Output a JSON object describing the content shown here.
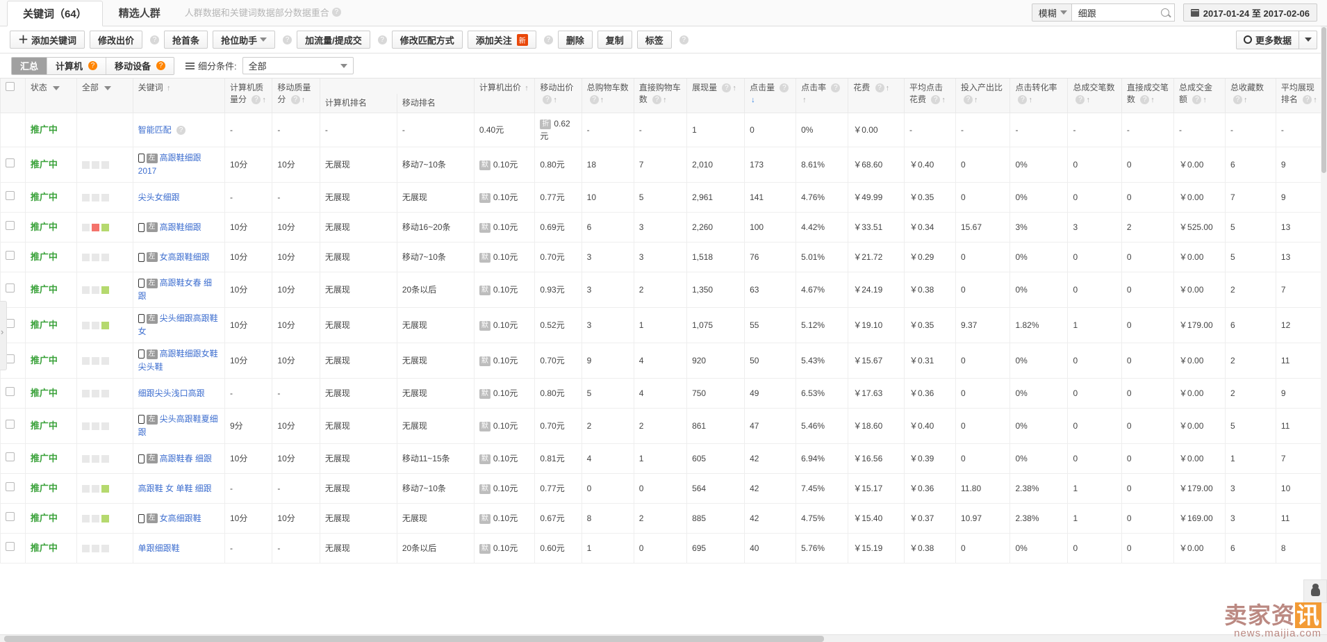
{
  "tabs": {
    "keyword_tab": "关键词（64）",
    "crowd_tab": "精选人群",
    "note": "人群数据和关键词数据部分数据重合"
  },
  "search": {
    "match_mode": "模糊",
    "value": "细跟",
    "icon": "search-icon"
  },
  "date_range": "2017-01-24 至 2017-02-06",
  "toolbar": {
    "add_keyword": "添加关键词",
    "modify_bid": "修改出价",
    "grab_top": "抢首条",
    "grab_assistant": "抢位助手",
    "add_traffic": "加流量/提成交",
    "modify_match": "修改匹配方式",
    "add_follow": "添加关注",
    "follow_badge": "新",
    "delete": "删除",
    "copy": "复制",
    "tag": "标签",
    "more_data": "更多数据"
  },
  "filters": {
    "summary": "汇总",
    "computer": "计算机",
    "mobile": "移动设备",
    "segment_label": "细分条件:",
    "segment_value": "全部"
  },
  "table": {
    "headers": {
      "status": "状态",
      "all": "全部",
      "keyword": "关键词",
      "pc_quality": "计算机质量分",
      "mobile_quality": "移动质量分",
      "pc_rank": "计算机排名",
      "mobile_rank": "移动排名",
      "pc_bid": "计算机出价",
      "mobile_bid": "移动出价",
      "total_cart": "总购物车数",
      "direct_cart": "直接购物车数",
      "impressions": "展现量",
      "clicks": "点击量",
      "ctr": "点击率",
      "cost": "花费",
      "avg_cpc": "平均点击花费",
      "roi": "投入产出比",
      "cvr": "点击转化率",
      "total_orders": "总成交笔数",
      "direct_orders": "直接成交笔数",
      "total_amount": "总成交金额",
      "total_favorites": "总收藏数",
      "avg_rank": "平均展现排名"
    },
    "labels": {
      "no_show": "无展现",
      "status_promoting": "推广中",
      "smart_match": "智能匹配",
      "tag_left": "左",
      "tag_default": "默",
      "tag_discount": "折"
    },
    "rows": [
      {
        "status": "推广中",
        "checkbox": false,
        "squares": [],
        "keyword": "智能匹配",
        "keyword_help": true,
        "mobile_icon": false,
        "left_tag": false,
        "pc_quality": "-",
        "mobile_quality": "-",
        "pc_rank": "-",
        "mobile_rank": "-",
        "pc_bid": "0.40元",
        "pc_bid_tag": "",
        "mobile_bid": "0.62元",
        "mobile_bid_tag": "折",
        "total_cart": "-",
        "direct_cart": "-",
        "impressions": "1",
        "clicks": "0",
        "ctr": "0%",
        "cost": "￥0.00",
        "avg_cpc": "-",
        "roi": "-",
        "cvr": "-",
        "total_orders": "-",
        "direct_orders": "-",
        "total_amount": "-",
        "total_favorites": "-",
        "avg_rank": "-"
      },
      {
        "status": "推广中",
        "checkbox": true,
        "squares": [
          "#e8e8e8",
          "#e8e8e8",
          "#e8e8e8"
        ],
        "keyword": "高跟鞋细跟2017",
        "keyword_help": false,
        "mobile_icon": true,
        "left_tag": true,
        "pc_quality": "10分",
        "mobile_quality": "10分",
        "pc_rank": "无展现",
        "mobile_rank": "移动7~10条",
        "pc_bid": "0.10元",
        "pc_bid_tag": "默",
        "mobile_bid": "0.80元",
        "mobile_bid_tag": "",
        "total_cart": "18",
        "direct_cart": "7",
        "impressions": "2,010",
        "clicks": "173",
        "ctr": "8.61%",
        "cost": "￥68.60",
        "avg_cpc": "￥0.40",
        "roi": "0",
        "cvr": "0%",
        "total_orders": "0",
        "direct_orders": "0",
        "total_amount": "￥0.00",
        "total_favorites": "6",
        "avg_rank": "9"
      },
      {
        "status": "推广中",
        "checkbox": true,
        "squares": [
          "#e8e8e8",
          "#e8e8e8",
          "#e8e8e8"
        ],
        "keyword": "尖头女细跟",
        "keyword_help": false,
        "mobile_icon": false,
        "left_tag": false,
        "pc_quality": "-",
        "mobile_quality": "-",
        "pc_rank": "无展现",
        "mobile_rank": "无展现",
        "pc_bid": "0.10元",
        "pc_bid_tag": "默",
        "mobile_bid": "0.77元",
        "mobile_bid_tag": "",
        "total_cart": "10",
        "direct_cart": "5",
        "impressions": "2,961",
        "clicks": "141",
        "ctr": "4.76%",
        "cost": "￥49.99",
        "avg_cpc": "￥0.35",
        "roi": "0",
        "cvr": "0%",
        "total_orders": "0",
        "direct_orders": "0",
        "total_amount": "￥0.00",
        "total_favorites": "7",
        "avg_rank": "9"
      },
      {
        "status": "推广中",
        "checkbox": true,
        "squares": [
          "#e8e8e8",
          "#f4736b",
          "#b5d96e"
        ],
        "keyword": "高跟鞋细跟",
        "keyword_help": false,
        "mobile_icon": true,
        "left_tag": true,
        "pc_quality": "10分",
        "mobile_quality": "10分",
        "pc_rank": "无展现",
        "mobile_rank": "移动16~20条",
        "pc_bid": "0.10元",
        "pc_bid_tag": "默",
        "mobile_bid": "0.69元",
        "mobile_bid_tag": "",
        "total_cart": "6",
        "direct_cart": "3",
        "impressions": "2,260",
        "clicks": "100",
        "ctr": "4.42%",
        "cost": "￥33.51",
        "avg_cpc": "￥0.34",
        "roi": "15.67",
        "cvr": "3%",
        "total_orders": "3",
        "direct_orders": "2",
        "total_amount": "￥525.00",
        "total_favorites": "5",
        "avg_rank": "13"
      },
      {
        "status": "推广中",
        "checkbox": true,
        "squares": [
          "#e8e8e8",
          "#e8e8e8",
          "#e8e8e8"
        ],
        "keyword": "女高跟鞋细跟",
        "keyword_help": false,
        "mobile_icon": true,
        "left_tag": true,
        "pc_quality": "10分",
        "mobile_quality": "10分",
        "pc_rank": "无展现",
        "mobile_rank": "移动7~10条",
        "pc_bid": "0.10元",
        "pc_bid_tag": "默",
        "mobile_bid": "0.70元",
        "mobile_bid_tag": "",
        "total_cart": "3",
        "direct_cart": "3",
        "impressions": "1,518",
        "clicks": "76",
        "ctr": "5.01%",
        "cost": "￥21.72",
        "avg_cpc": "￥0.29",
        "roi": "0",
        "cvr": "0%",
        "total_orders": "0",
        "direct_orders": "0",
        "total_amount": "￥0.00",
        "total_favorites": "5",
        "avg_rank": "13"
      },
      {
        "status": "推广中",
        "checkbox": true,
        "squares": [
          "#e8e8e8",
          "#e8e8e8",
          "#b5d96e"
        ],
        "keyword": "高跟鞋女春 细跟",
        "keyword_help": false,
        "mobile_icon": true,
        "left_tag": true,
        "pc_quality": "10分",
        "mobile_quality": "10分",
        "pc_rank": "无展现",
        "mobile_rank": "20条以后",
        "pc_bid": "0.10元",
        "pc_bid_tag": "默",
        "mobile_bid": "0.93元",
        "mobile_bid_tag": "",
        "total_cart": "3",
        "direct_cart": "2",
        "impressions": "1,350",
        "clicks": "63",
        "ctr": "4.67%",
        "cost": "￥24.19",
        "avg_cpc": "￥0.38",
        "roi": "0",
        "cvr": "0%",
        "total_orders": "0",
        "direct_orders": "0",
        "total_amount": "￥0.00",
        "total_favorites": "2",
        "avg_rank": "7"
      },
      {
        "status": "推广中",
        "checkbox": true,
        "squares": [
          "#e8e8e8",
          "#e8e8e8",
          "#b5d96e"
        ],
        "keyword": "尖头细跟高跟鞋女",
        "keyword_help": false,
        "mobile_icon": true,
        "left_tag": true,
        "pc_quality": "10分",
        "mobile_quality": "10分",
        "pc_rank": "无展现",
        "mobile_rank": "无展现",
        "pc_bid": "0.10元",
        "pc_bid_tag": "默",
        "mobile_bid": "0.52元",
        "mobile_bid_tag": "",
        "total_cart": "3",
        "direct_cart": "1",
        "impressions": "1,075",
        "clicks": "55",
        "ctr": "5.12%",
        "cost": "￥19.10",
        "avg_cpc": "￥0.35",
        "roi": "9.37",
        "cvr": "1.82%",
        "total_orders": "1",
        "direct_orders": "0",
        "total_amount": "￥179.00",
        "total_favorites": "6",
        "avg_rank": "12"
      },
      {
        "status": "推广中",
        "checkbox": true,
        "squares": [
          "#e8e8e8",
          "#e8e8e8",
          "#e8e8e8"
        ],
        "keyword": "高跟鞋细跟女鞋尖头鞋",
        "keyword_help": false,
        "mobile_icon": true,
        "left_tag": true,
        "pc_quality": "10分",
        "mobile_quality": "10分",
        "pc_rank": "无展现",
        "mobile_rank": "无展现",
        "pc_bid": "0.10元",
        "pc_bid_tag": "默",
        "mobile_bid": "0.70元",
        "mobile_bid_tag": "",
        "total_cart": "9",
        "direct_cart": "4",
        "impressions": "920",
        "clicks": "50",
        "ctr": "5.43%",
        "cost": "￥15.67",
        "avg_cpc": "￥0.31",
        "roi": "0",
        "cvr": "0%",
        "total_orders": "0",
        "direct_orders": "0",
        "total_amount": "￥0.00",
        "total_favorites": "2",
        "avg_rank": "11"
      },
      {
        "status": "推广中",
        "checkbox": true,
        "squares": [
          "#e8e8e8",
          "#e8e8e8",
          "#e8e8e8"
        ],
        "keyword": "细跟尖头浅口高跟",
        "keyword_help": false,
        "mobile_icon": false,
        "left_tag": false,
        "pc_quality": "-",
        "mobile_quality": "-",
        "pc_rank": "无展现",
        "mobile_rank": "无展现",
        "pc_bid": "0.10元",
        "pc_bid_tag": "默",
        "mobile_bid": "0.80元",
        "mobile_bid_tag": "",
        "total_cart": "5",
        "direct_cart": "4",
        "impressions": "750",
        "clicks": "49",
        "ctr": "6.53%",
        "cost": "￥17.63",
        "avg_cpc": "￥0.36",
        "roi": "0",
        "cvr": "0%",
        "total_orders": "0",
        "direct_orders": "0",
        "total_amount": "￥0.00",
        "total_favorites": "2",
        "avg_rank": "9"
      },
      {
        "status": "推广中",
        "checkbox": true,
        "squares": [
          "#e8e8e8",
          "#e8e8e8",
          "#e8e8e8"
        ],
        "keyword": "尖头高跟鞋夏细跟",
        "keyword_help": false,
        "mobile_icon": true,
        "left_tag": true,
        "pc_quality": "9分",
        "mobile_quality": "10分",
        "pc_rank": "无展现",
        "mobile_rank": "无展现",
        "pc_bid": "0.10元",
        "pc_bid_tag": "默",
        "mobile_bid": "0.70元",
        "mobile_bid_tag": "",
        "total_cart": "2",
        "direct_cart": "2",
        "impressions": "861",
        "clicks": "47",
        "ctr": "5.46%",
        "cost": "￥18.60",
        "avg_cpc": "￥0.40",
        "roi": "0",
        "cvr": "0%",
        "total_orders": "0",
        "direct_orders": "0",
        "total_amount": "￥0.00",
        "total_favorites": "5",
        "avg_rank": "11"
      },
      {
        "status": "推广中",
        "checkbox": true,
        "squares": [
          "#e8e8e8",
          "#e8e8e8",
          "#e8e8e8"
        ],
        "keyword": "高跟鞋春 细跟",
        "keyword_help": false,
        "mobile_icon": true,
        "left_tag": true,
        "pc_quality": "10分",
        "mobile_quality": "10分",
        "pc_rank": "无展现",
        "mobile_rank": "移动11~15条",
        "pc_bid": "0.10元",
        "pc_bid_tag": "默",
        "mobile_bid": "0.81元",
        "mobile_bid_tag": "",
        "total_cart": "4",
        "direct_cart": "1",
        "impressions": "605",
        "clicks": "42",
        "ctr": "6.94%",
        "cost": "￥16.56",
        "avg_cpc": "￥0.39",
        "roi": "0",
        "cvr": "0%",
        "total_orders": "0",
        "direct_orders": "0",
        "total_amount": "￥0.00",
        "total_favorites": "1",
        "avg_rank": "7"
      },
      {
        "status": "推广中",
        "checkbox": true,
        "squares": [
          "#e8e8e8",
          "#e8e8e8",
          "#b5d96e"
        ],
        "keyword": "高跟鞋 女 单鞋 细跟",
        "keyword_help": false,
        "mobile_icon": false,
        "left_tag": false,
        "pc_quality": "-",
        "mobile_quality": "-",
        "pc_rank": "无展现",
        "mobile_rank": "移动7~10条",
        "pc_bid": "0.10元",
        "pc_bid_tag": "默",
        "mobile_bid": "0.77元",
        "mobile_bid_tag": "",
        "total_cart": "0",
        "direct_cart": "0",
        "impressions": "564",
        "clicks": "42",
        "ctr": "7.45%",
        "cost": "￥15.17",
        "avg_cpc": "￥0.36",
        "roi": "11.80",
        "cvr": "2.38%",
        "total_orders": "1",
        "direct_orders": "0",
        "total_amount": "￥179.00",
        "total_favorites": "3",
        "avg_rank": "10"
      },
      {
        "status": "推广中",
        "checkbox": true,
        "squares": [
          "#e8e8e8",
          "#e8e8e8",
          "#b5d96e"
        ],
        "keyword": "女高细跟鞋",
        "keyword_help": false,
        "mobile_icon": true,
        "left_tag": true,
        "pc_quality": "10分",
        "mobile_quality": "10分",
        "pc_rank": "无展现",
        "mobile_rank": "无展现",
        "pc_bid": "0.10元",
        "pc_bid_tag": "默",
        "mobile_bid": "0.67元",
        "mobile_bid_tag": "",
        "total_cart": "8",
        "direct_cart": "2",
        "impressions": "885",
        "clicks": "42",
        "ctr": "4.75%",
        "cost": "￥15.40",
        "avg_cpc": "￥0.37",
        "roi": "10.97",
        "cvr": "2.38%",
        "total_orders": "1",
        "direct_orders": "0",
        "total_amount": "￥169.00",
        "total_favorites": "3",
        "avg_rank": "11"
      },
      {
        "status": "推广中",
        "checkbox": true,
        "squares": [
          "#e8e8e8",
          "#e8e8e8",
          "#e8e8e8"
        ],
        "keyword": "单跟细跟鞋",
        "keyword_help": false,
        "mobile_icon": false,
        "left_tag": false,
        "pc_quality": "-",
        "mobile_quality": "-",
        "pc_rank": "无展现",
        "mobile_rank": "20条以后",
        "pc_bid": "0.10元",
        "pc_bid_tag": "默",
        "mobile_bid": "0.60元",
        "mobile_bid_tag": "",
        "total_cart": "1",
        "direct_cart": "0",
        "impressions": "695",
        "clicks": "40",
        "ctr": "5.76%",
        "cost": "￥15.19",
        "avg_cpc": "￥0.38",
        "roi": "0",
        "cvr": "0%",
        "total_orders": "0",
        "direct_orders": "0",
        "total_amount": "￥0.00",
        "total_favorites": "6",
        "avg_rank": "8"
      }
    ]
  },
  "watermark": {
    "line1_a": "卖家资",
    "line1_b": "讯",
    "line2": "news.maijia.com"
  }
}
